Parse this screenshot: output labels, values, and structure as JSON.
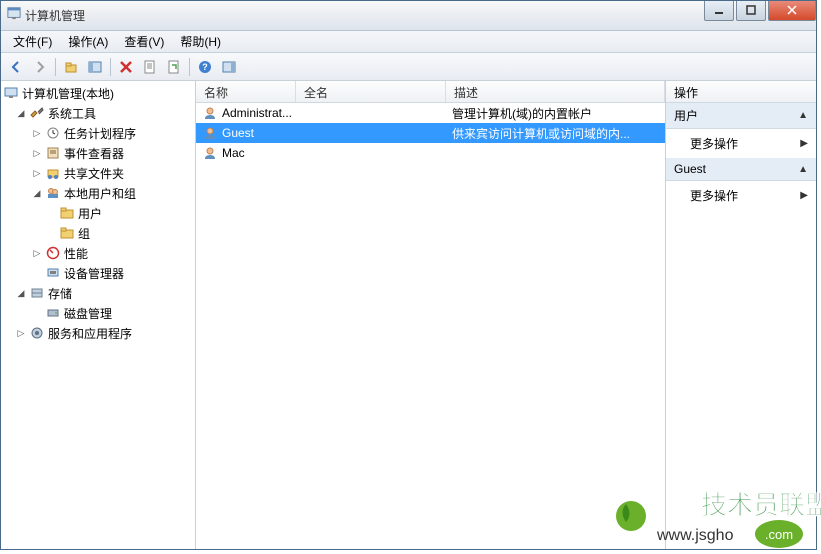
{
  "window": {
    "title": "计算机管理"
  },
  "menus": {
    "file": "文件(F)",
    "action": "操作(A)",
    "view": "查看(V)",
    "help": "帮助(H)"
  },
  "tree": {
    "root": "计算机管理(本地)",
    "system_tools": "系统工具",
    "task_scheduler": "任务计划程序",
    "event_viewer": "事件查看器",
    "shared_folders": "共享文件夹",
    "local_users": "本地用户和组",
    "users": "用户",
    "groups": "组",
    "performance": "性能",
    "device_manager": "设备管理器",
    "storage": "存储",
    "disk_management": "磁盘管理",
    "services_apps": "服务和应用程序"
  },
  "list": {
    "headers": {
      "name": "名称",
      "fullname": "全名",
      "description": "描述"
    },
    "rows": [
      {
        "name": "Administrat...",
        "fullname": "",
        "description": "管理计算机(域)的内置帐户",
        "selected": false
      },
      {
        "name": "Guest",
        "fullname": "",
        "description": "供来宾访问计算机或访问域的内...",
        "selected": true
      },
      {
        "name": "Mac",
        "fullname": "",
        "description": "",
        "selected": false
      }
    ]
  },
  "actions": {
    "header": "操作",
    "section1": "用户",
    "more1": "更多操作",
    "section2": "Guest",
    "more2": "更多操作"
  },
  "watermark": {
    "brand": "技术员联盟",
    "url": "www.jsgho.com",
    "tag": ".com"
  }
}
